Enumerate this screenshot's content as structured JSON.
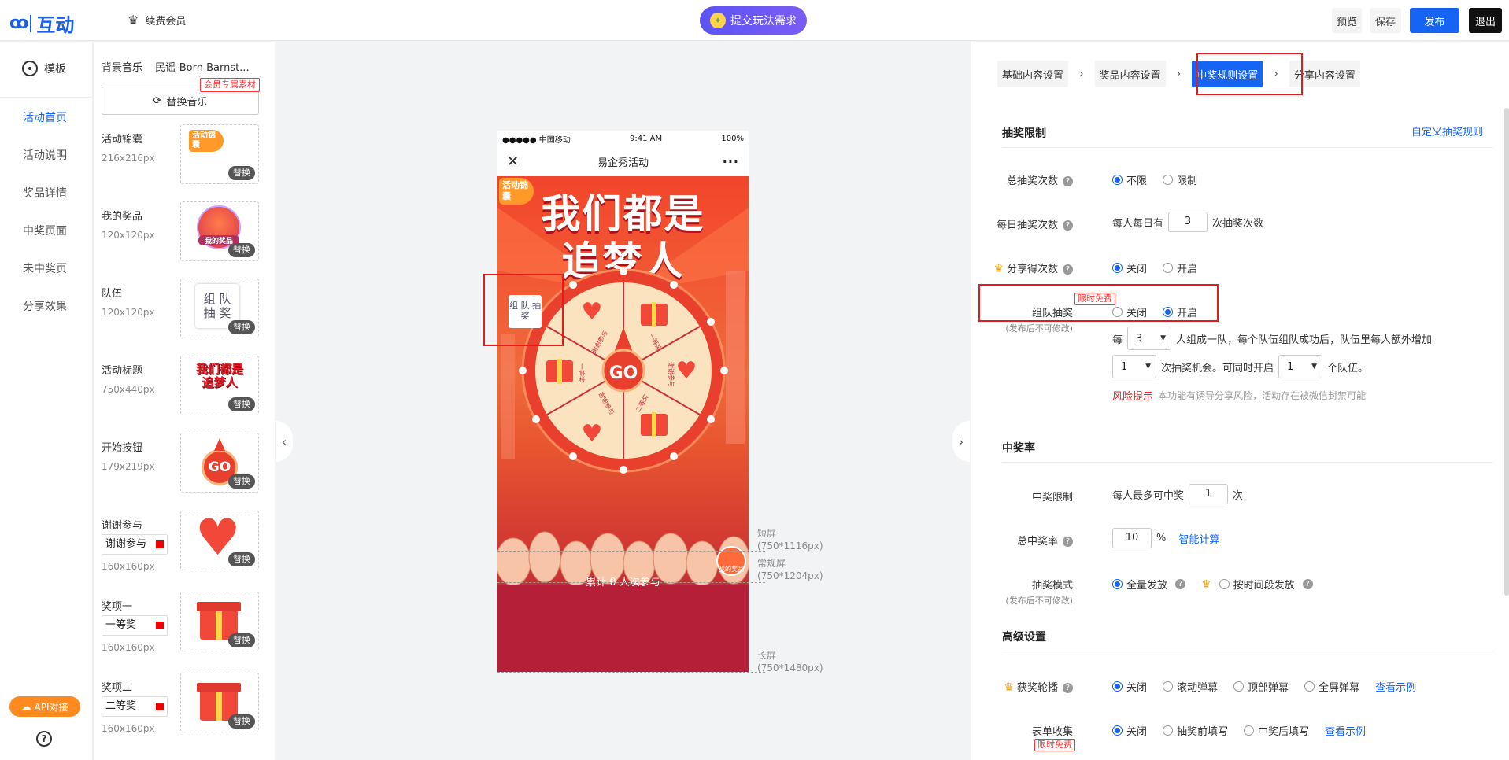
{
  "header": {
    "brand": "互动",
    "vip_label": "续费会员",
    "submit_request": "提交玩法需求",
    "preview": "预览",
    "save": "保存",
    "publish": "发布",
    "exit": "退出"
  },
  "leftnav": {
    "template": "模板",
    "items": [
      "活动首页",
      "活动说明",
      "奖品详情",
      "中奖页面",
      "未中奖页",
      "分享效果"
    ],
    "api": "API对接",
    "help": "?"
  },
  "assets": {
    "music_label": "背景音乐",
    "music_name": "民谣-Born Barnst...",
    "vip_material": "会员专属素材",
    "replace_music": "替换音乐",
    "replace": "替换",
    "items": [
      {
        "name": "活动锦囊",
        "size": "216x216px"
      },
      {
        "name": "我的奖品",
        "size": "120x120px"
      },
      {
        "name": "队伍",
        "size": "120x120px"
      },
      {
        "name": "活动标题",
        "size": "750x440px"
      },
      {
        "name": "开始按钮",
        "size": "179x219px"
      },
      {
        "name": "谢谢参与",
        "size": "160x160px",
        "text": "谢谢参与"
      },
      {
        "name": "奖项一",
        "size": "160x160px",
        "text": "一等奖"
      },
      {
        "name": "奖项二",
        "size": "160x160px",
        "text": "二等奖"
      }
    ],
    "thumb_texts": {
      "jinnang": "活动锦囊",
      "myprize": "我的奖品",
      "team": "组 队\n抽 奖",
      "title": "我们都是追梦人",
      "go": "GO"
    }
  },
  "phone": {
    "carrier": "●●●●● 中国移动",
    "time": "9:41 AM",
    "battery": "100%",
    "title": "易企秀活动",
    "jinnang": "活动锦囊",
    "headline_1": "我们都是",
    "headline_2": "追梦人",
    "team_badge": "组 队 抽 奖",
    "go": "GO",
    "slices": [
      "谢谢参与",
      "一等奖",
      "谢谢参与",
      "二等奖",
      "谢谢参与",
      "一等奖"
    ],
    "count": "累计 0 人次参与",
    "myprize": "我的奖品"
  },
  "guides": {
    "short": "短屏\n(750*1116px)",
    "normal": "常规屏\n(750*1204px)",
    "long": "长屏\n(750*1480px)"
  },
  "settings": {
    "steps": [
      "基础内容设置",
      "奖品内容设置",
      "中奖规则设置",
      "分享内容设置"
    ],
    "limit_title": "抽奖限制",
    "custom_rule": "自定义抽奖规则",
    "total_label": "总抽奖次数",
    "total_opts": [
      "不限",
      "限制"
    ],
    "daily_label": "每日抽奖次数",
    "daily_prefix": "每人每日有",
    "daily_value": "3",
    "daily_suffix": "次抽奖次数",
    "share_label": "分享得次数",
    "onoff": [
      "关闭",
      "开启"
    ],
    "free_tag": "限时免费",
    "team_label": "组队抽奖",
    "team_note": "(发布后不可修改)",
    "team_each": "每",
    "team_size": "3",
    "team_text1": "人组成一队，每个队伍组队成功后，队伍里每人额外增加",
    "team_extra": "1",
    "team_text2": "次抽奖机会。可同时开启",
    "team_count": "1",
    "team_text3": "个队伍。",
    "risk_label": "风险提示",
    "risk_text": "本功能有诱导分享风险，活动存在被微信封禁可能",
    "rate_title": "中奖率",
    "win_limit_label": "中奖限制",
    "win_limit_prefix": "每人最多可中奖",
    "win_limit_value": "1",
    "win_limit_suffix": "次",
    "total_rate_label": "总中奖率",
    "total_rate_value": "10",
    "percent": "%",
    "smart_calc": "智能计算",
    "mode_label": "抽奖模式",
    "mode_note": "(发布后不可修改)",
    "mode_opts": [
      "全量发放",
      "按时间段发放"
    ],
    "advanced_title": "高级设置",
    "carousel_label": "获奖轮播",
    "carousel_opts": [
      "关闭",
      "滚动弹幕",
      "顶部弹幕",
      "全屏弹幕"
    ],
    "see_example": "查看示例",
    "form_label": "表单收集",
    "form_opts": [
      "关闭",
      "抽奖前填写",
      "中奖后填写"
    ],
    "form_free": "限时免费"
  }
}
